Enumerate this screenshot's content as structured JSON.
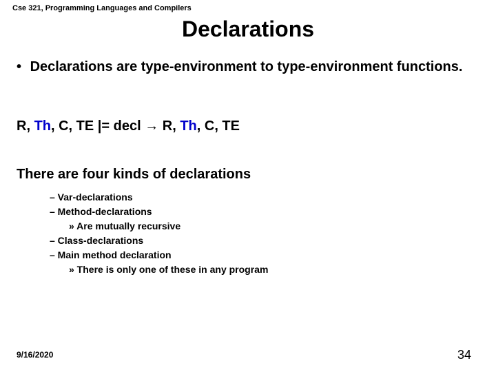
{
  "header": "Cse 321, Programming Languages and Compilers",
  "title": "Declarations",
  "bullet_dot": "•",
  "bullet_text": "Declarations are type-environment to type-environment functions.",
  "rule": {
    "r1": "R, ",
    "th": "Th",
    "rest1": ", C, TE   |=   decl   ",
    "arrow": "→",
    "gap": "   R, ",
    "th2": "Th",
    "rest2": ", C, TE"
  },
  "subheading": "There are four kinds of declarations",
  "items": {
    "i0": "– Var-declarations",
    "i1": "– Method-declarations",
    "i1a": "» Are mutually recursive",
    "i2": "– Class-declarations",
    "i3": "– Main method declaration",
    "i3a": "» There is only one of these in any program"
  },
  "date": "9/16/2020",
  "page": "34"
}
